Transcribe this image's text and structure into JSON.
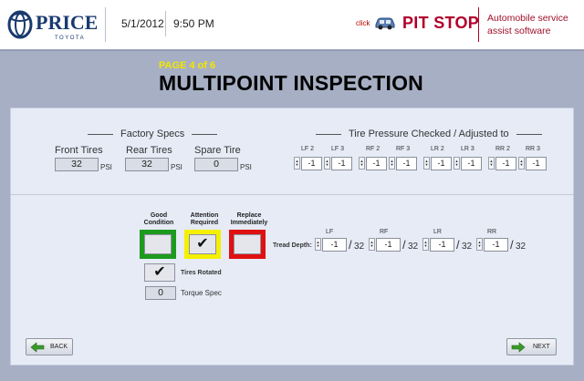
{
  "header": {
    "logo_text": "PRICE",
    "logo_sub": "TOYOTA",
    "date": "5/1/2012",
    "time": "9:50 PM",
    "click_label": "click",
    "car_icon": "car-icon",
    "pit_stop": "PIT STOP",
    "tagline": "Automobile service assist software"
  },
  "page": {
    "indicator": "PAGE 4 of 6",
    "title": "MULTIPOINT INSPECTION"
  },
  "factory_specs": {
    "title": "Factory Specs",
    "front_label": "Front Tires",
    "front_value": "32",
    "rear_label": "Rear Tires",
    "rear_value": "32",
    "spare_label": "Spare Tire",
    "spare_value": "0",
    "unit": "PSI"
  },
  "tire_pressure": {
    "title": "Tire Pressure Checked / Adjusted to",
    "fields": [
      {
        "label": "LF 2",
        "value": "-1"
      },
      {
        "label": "LF 3",
        "value": "-1"
      },
      {
        "label": "RF 2",
        "value": "-1"
      },
      {
        "label": "RF 3",
        "value": "-1"
      },
      {
        "label": "LR 2",
        "value": "-1"
      },
      {
        "label": "LR 3",
        "value": "-1"
      },
      {
        "label": "RR 2",
        "value": "-1"
      },
      {
        "label": "RR 3",
        "value": "-1"
      }
    ]
  },
  "condition": {
    "good": {
      "label": "Good Condition",
      "color": "#1e9a1e",
      "checked": false
    },
    "attention": {
      "label": "Attention Required",
      "color": "#f4f000",
      "checked": true
    },
    "replace": {
      "label": "Replace Immediately",
      "color": "#e01010",
      "checked": false
    }
  },
  "tread_depth": {
    "label": "Tread Depth:",
    "denominator": "32",
    "fields": [
      {
        "label": "LF",
        "value": "-1"
      },
      {
        "label": "RF",
        "value": "-1"
      },
      {
        "label": "LR",
        "value": "-1"
      },
      {
        "label": "RR",
        "value": "-1"
      }
    ]
  },
  "tires_rotated": {
    "label": "Tires Rotated",
    "checked": true
  },
  "torque": {
    "value": "0",
    "label": "Torque Spec"
  },
  "nav": {
    "back_label": "BACK",
    "next_label": "NEXT"
  },
  "colors": {
    "arrow_green": "#3a9a2a",
    "brand_red": "#b0002a",
    "page_yellow": "#f2e600"
  }
}
